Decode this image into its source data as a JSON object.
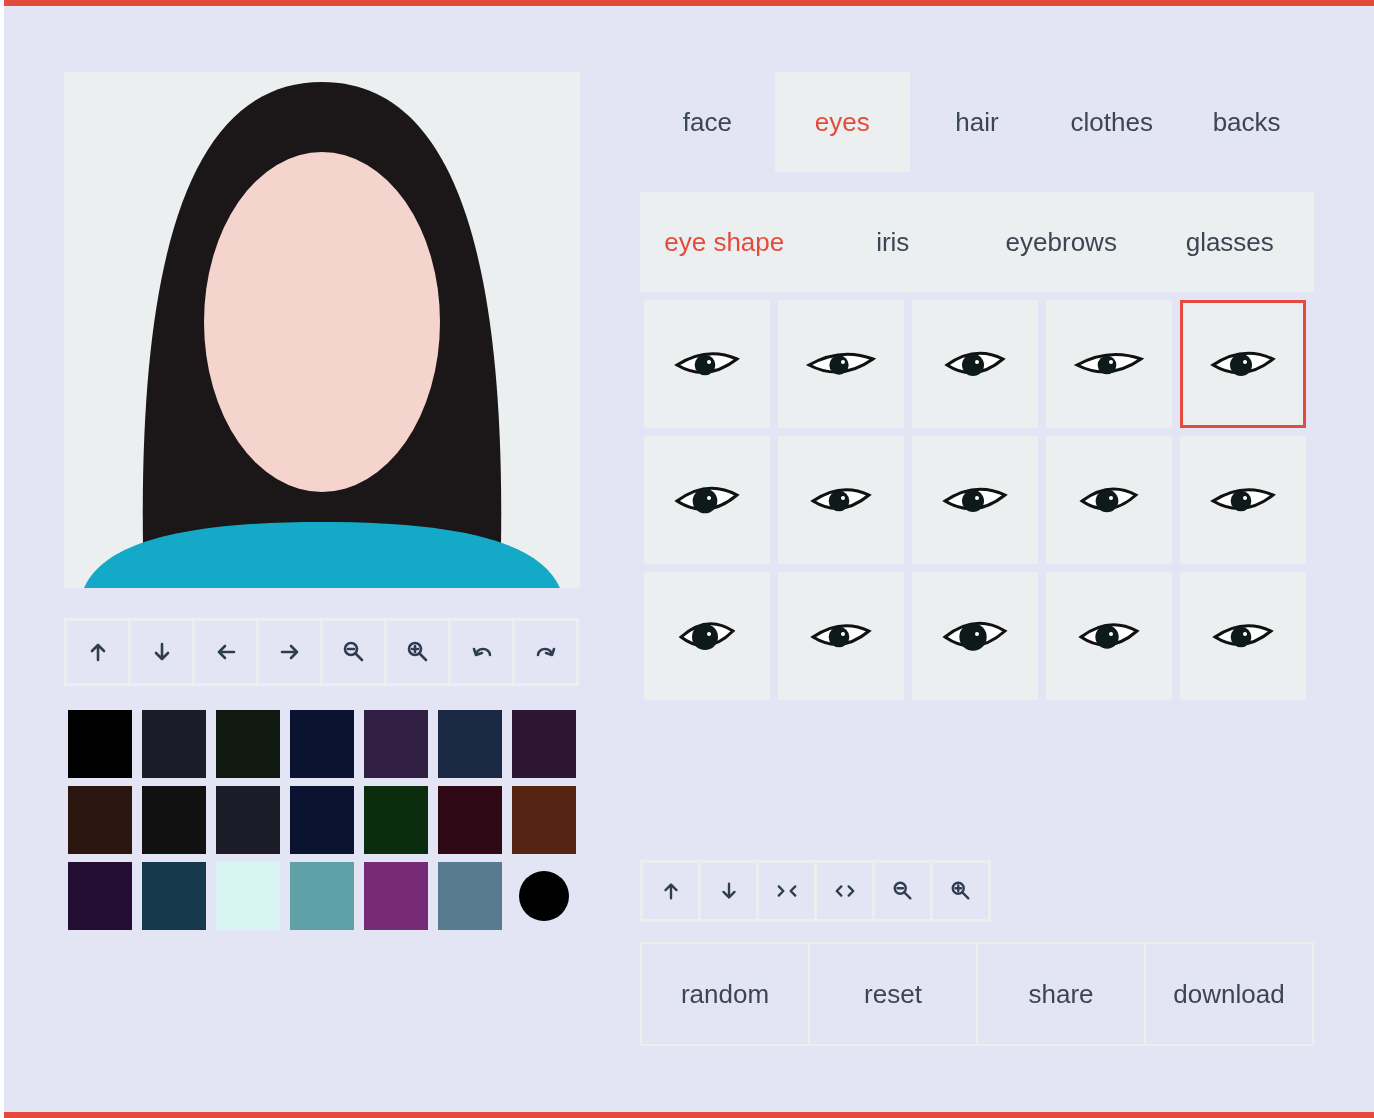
{
  "tabs": [
    {
      "label": "face",
      "selected": false
    },
    {
      "label": "eyes",
      "selected": true
    },
    {
      "label": "hair",
      "selected": false
    },
    {
      "label": "clothes",
      "selected": false
    },
    {
      "label": "backs",
      "selected": false
    }
  ],
  "subtabs": [
    {
      "label": "eye shape",
      "selected": true
    },
    {
      "label": "iris",
      "selected": false
    },
    {
      "label": "eyebrows",
      "selected": false
    },
    {
      "label": "glasses",
      "selected": false
    }
  ],
  "eye_options": [
    {
      "selected": false
    },
    {
      "selected": false
    },
    {
      "selected": false
    },
    {
      "selected": false
    },
    {
      "selected": true
    },
    {
      "selected": false
    },
    {
      "selected": false
    },
    {
      "selected": false
    },
    {
      "selected": false
    },
    {
      "selected": false
    },
    {
      "selected": false
    },
    {
      "selected": false
    },
    {
      "selected": false
    },
    {
      "selected": false
    },
    {
      "selected": false
    }
  ],
  "avatar_tools": [
    {
      "kind": "up"
    },
    {
      "kind": "down"
    },
    {
      "kind": "left"
    },
    {
      "kind": "right"
    },
    {
      "kind": "zoom-out"
    },
    {
      "kind": "zoom-in"
    },
    {
      "kind": "undo"
    },
    {
      "kind": "redo"
    }
  ],
  "swatches": [
    {
      "color": "#000000",
      "selected": false
    },
    {
      "color": "#1c1b28",
      "selected": false
    },
    {
      "color": "#10190f",
      "selected": false
    },
    {
      "color": "#0a1430",
      "selected": false
    },
    {
      "color": "#312044",
      "selected": false
    },
    {
      "color": "#1b2a42",
      "selected": false
    },
    {
      "color": "#2e1531",
      "selected": false
    },
    {
      "color": "#2c1710",
      "selected": false
    },
    {
      "color": "#121112",
      "selected": false
    },
    {
      "color": "#1c1b28",
      "selected": false
    },
    {
      "color": "#0a1430",
      "selected": false
    },
    {
      "color": "#0a2e0d",
      "selected": false
    },
    {
      "color": "#2e0814",
      "selected": false
    },
    {
      "color": "#562413",
      "selected": false
    },
    {
      "color": "#230d33",
      "selected": false
    },
    {
      "color": "#16394b",
      "selected": false
    },
    {
      "color": "#d6f5f3",
      "selected": false
    },
    {
      "color": "#5ea1a6",
      "selected": false
    },
    {
      "color": "#772a75",
      "selected": false
    },
    {
      "color": "#577c90",
      "selected": false
    },
    {
      "color": "#000000",
      "selected": true
    }
  ],
  "part_tools": [
    {
      "kind": "up"
    },
    {
      "kind": "down"
    },
    {
      "kind": "narrow"
    },
    {
      "kind": "widen"
    },
    {
      "kind": "zoom-out"
    },
    {
      "kind": "zoom-in"
    }
  ],
  "actions": [
    "random",
    "reset",
    "share",
    "download"
  ]
}
